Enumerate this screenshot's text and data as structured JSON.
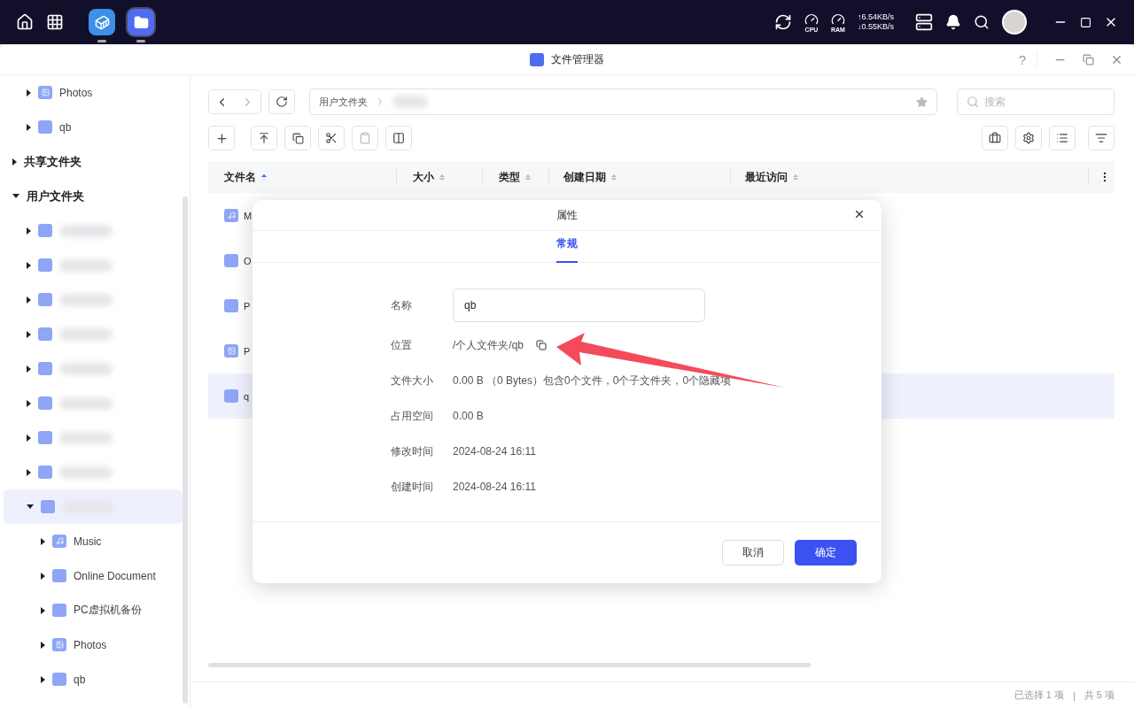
{
  "taskbar": {
    "apps": [
      {
        "kind": "docker",
        "running": true,
        "selected": false
      },
      {
        "kind": "files",
        "running": true,
        "selected": true
      }
    ],
    "cpu_label": "CPU",
    "ram_label": "RAM",
    "upload": "↑6.54KB/s",
    "download": "↓0.55KB/s"
  },
  "window": {
    "title": "文件管理器",
    "help": "?"
  },
  "sidebar": {
    "scrolled_items": [
      {
        "label": "Photos",
        "kind": "photos",
        "expanded": false
      },
      {
        "label": "qb",
        "kind": "folder",
        "expanded": false
      }
    ],
    "tree": [
      {
        "label": "共享文件夹",
        "kind": "section",
        "expanded": false,
        "selected": false
      },
      {
        "label": "用户文件夹",
        "kind": "section",
        "expanded": true,
        "selected": false,
        "children": [
          {
            "kind": "blurred",
            "expanded": false,
            "selected": false
          },
          {
            "kind": "blurred",
            "expanded": false,
            "selected": false
          },
          {
            "kind": "blurred",
            "expanded": false,
            "selected": false
          },
          {
            "kind": "blurred",
            "expanded": false,
            "selected": false
          },
          {
            "kind": "blurred",
            "expanded": false,
            "selected": false
          },
          {
            "kind": "blurred",
            "expanded": false,
            "selected": false
          },
          {
            "kind": "blurred",
            "expanded": false,
            "selected": false
          },
          {
            "kind": "blurred",
            "expanded": false,
            "selected": false
          },
          {
            "kind": "blurred",
            "expanded": true,
            "selected": true,
            "children": [
              {
                "label": "Music",
                "kind": "music",
                "expanded": false,
                "selected": false
              },
              {
                "label": "Online Document",
                "kind": "folder",
                "expanded": false,
                "selected": false
              },
              {
                "label": "PC虚拟机备份",
                "kind": "folder",
                "expanded": false,
                "selected": false
              },
              {
                "label": "Photos",
                "kind": "photos",
                "expanded": false,
                "selected": false
              },
              {
                "label": "qb",
                "kind": "folder",
                "expanded": false,
                "selected": false
              }
            ]
          }
        ]
      }
    ]
  },
  "breadcrumb": {
    "items": [
      "用户文件夹"
    ],
    "current_blurred": true
  },
  "search": {
    "placeholder": "搜索"
  },
  "table": {
    "columns": [
      {
        "label": "文件名",
        "sorted": true
      },
      {
        "label": "大小",
        "sorted": false
      },
      {
        "label": "类型",
        "sorted": false
      },
      {
        "label": "创建日期",
        "sorted": false
      },
      {
        "label": "最近访问",
        "sorted": false
      }
    ],
    "rows": [
      {
        "name": "M",
        "kind": "music",
        "selected": false
      },
      {
        "name": "O",
        "kind": "folder",
        "selected": false
      },
      {
        "name": "P",
        "kind": "folder",
        "selected": false
      },
      {
        "name": "P",
        "kind": "photos",
        "selected": false
      },
      {
        "name": "q",
        "kind": "folder",
        "selected": true
      }
    ]
  },
  "status_bar": {
    "selected": "已选择 1 项",
    "separator": "|",
    "total": "共 5 项"
  },
  "dialog": {
    "title": "属性",
    "tabs": [
      {
        "label": "常规",
        "selected": true
      }
    ],
    "name_label": "名称",
    "name_value": "qb",
    "fields": [
      {
        "label": "位置",
        "value": "/个人文件夹/qb",
        "copyable": true
      },
      {
        "label": "文件大小",
        "value": "0.00 B （0 Bytes）包含0个文件，0个子文件夹，0个隐藏项",
        "copyable": false
      },
      {
        "label": "占用空间",
        "value": "0.00 B",
        "copyable": false
      },
      {
        "label": "修改时间",
        "value": "2024-08-24 16:11",
        "copyable": false
      },
      {
        "label": "创建时间",
        "value": "2024-08-24 16:11",
        "copyable": false
      }
    ],
    "cancel": "取消",
    "ok": "确定",
    "annotation_arrow": true
  }
}
